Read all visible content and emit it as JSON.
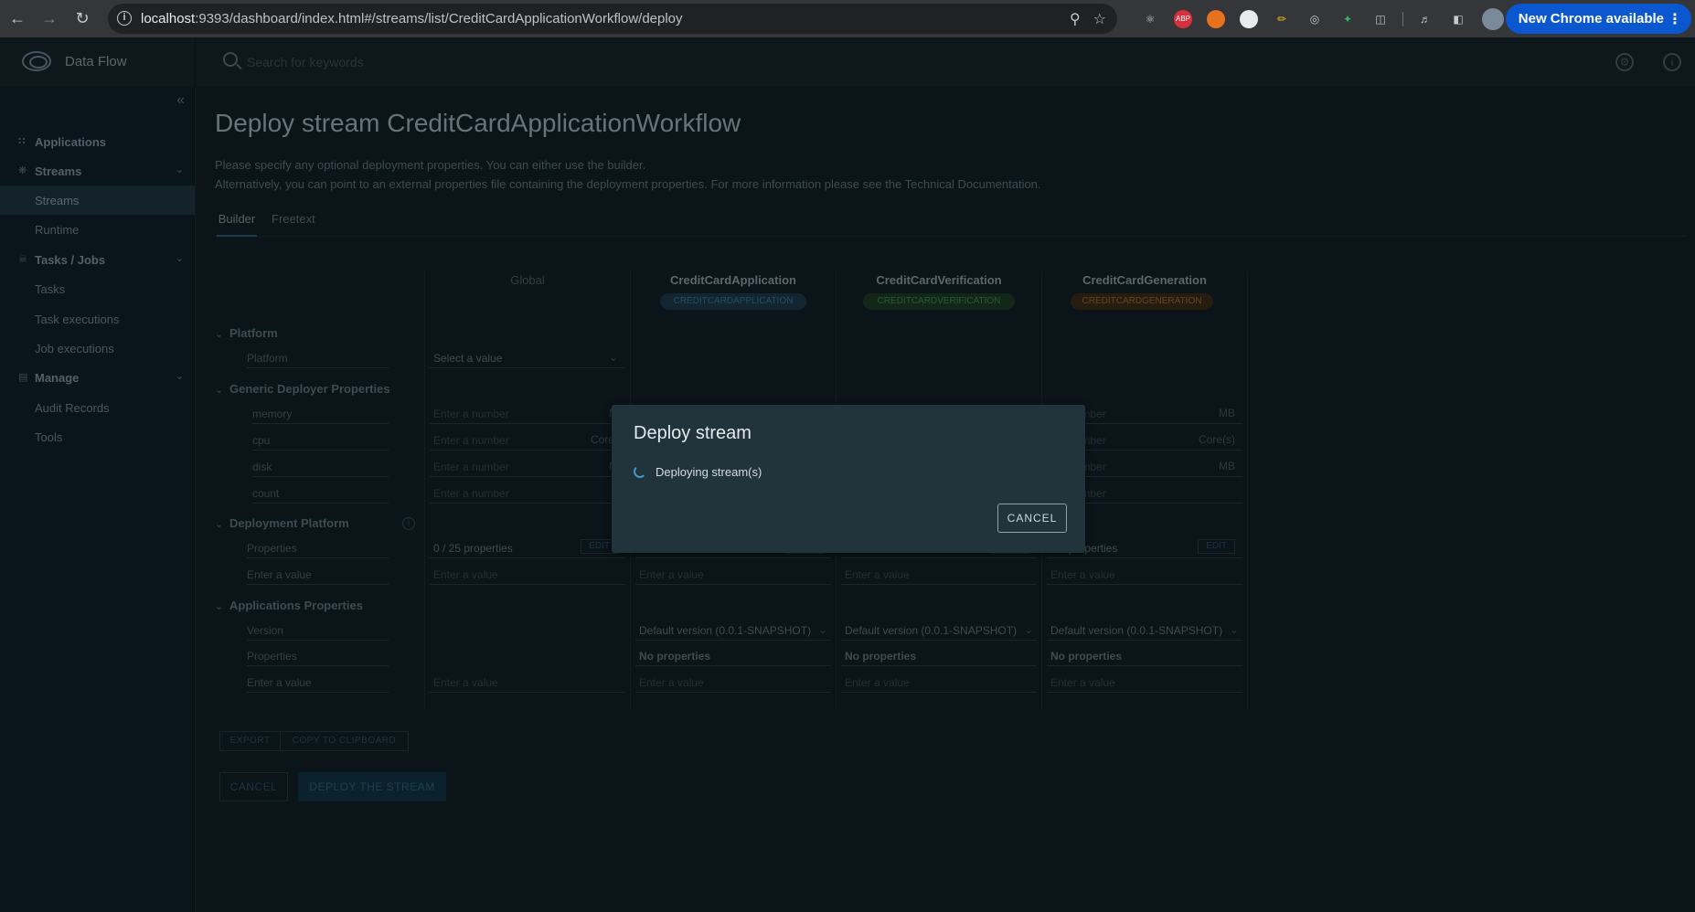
{
  "browser": {
    "url_host": "localhost",
    "url_rest": ":9393/dashboard/index.html#/streams/list/CreditCardApplicationWorkflow/deploy",
    "new_chrome": "New Chrome available",
    "abp_label": "ABP"
  },
  "header": {
    "app_title": "Data Flow",
    "search_placeholder": "Search for keywords"
  },
  "sidebar": {
    "items": [
      {
        "label": "Applications"
      },
      {
        "label": "Streams"
      },
      {
        "label": "Streams"
      },
      {
        "label": "Runtime"
      },
      {
        "label": "Tasks / Jobs"
      },
      {
        "label": "Tasks"
      },
      {
        "label": "Task executions"
      },
      {
        "label": "Job executions"
      },
      {
        "label": "Manage"
      },
      {
        "label": "Audit Records"
      },
      {
        "label": "Tools"
      }
    ]
  },
  "page": {
    "title": "Deploy stream CreditCardApplicationWorkflow",
    "desc1": "Please specify any optional deployment properties. You can either use the builder.",
    "desc2": "Alternatively, you can point to an external properties file containing the deployment properties. For more information please see the Technical Documentation.",
    "tabs": [
      "Builder",
      "Freetext"
    ]
  },
  "builder": {
    "global_header": "Global",
    "apps": [
      {
        "name": "CreditCardApplication",
        "badge": "CREDITCARDAPPLICATION",
        "color": "#36789b"
      },
      {
        "name": "CreditCardVerification",
        "badge": "CREDITCARDVERIFICATION",
        "color": "#3f8a4f"
      },
      {
        "name": "CreditCardGeneration",
        "badge": "CREDITCARDGENERATION",
        "color": "#9e6b2e"
      }
    ],
    "sections": {
      "platform": "Platform",
      "generic": "Generic Deployer Properties",
      "deployment_platform": "Deployment Platform",
      "app_props": "Applications Properties"
    },
    "labels": {
      "platform": "Platform",
      "memory": "memory",
      "cpu": "cpu",
      "disk": "disk",
      "count": "count",
      "properties": "Properties",
      "enter_value": "Enter a value",
      "version": "Version"
    },
    "placeholders": {
      "select_value": "Select a value",
      "enter_number": "Enter a number",
      "enter_value": "Enter a value",
      "number_cut": "number"
    },
    "units": {
      "mb": "MB",
      "mb_cut": "M",
      "cores": "Core(s)",
      "cores_cut": "Core("
    },
    "props_count": "0 / 25 properties",
    "props_count_cut": "0 / 25 properties",
    "props_cut": "properties",
    "edit": "EDIT",
    "default_version": "Default version (0.0.1-SNAPSHOT)",
    "no_properties": "No properties"
  },
  "actions": {
    "export": "EXPORT",
    "copy": "COPY TO CLIPBOARD",
    "cancel": "CANCEL",
    "deploy": "DEPLOY THE STREAM"
  },
  "modal": {
    "title": "Deploy stream",
    "message": "Deploying stream(s)",
    "cancel": "CANCEL"
  }
}
